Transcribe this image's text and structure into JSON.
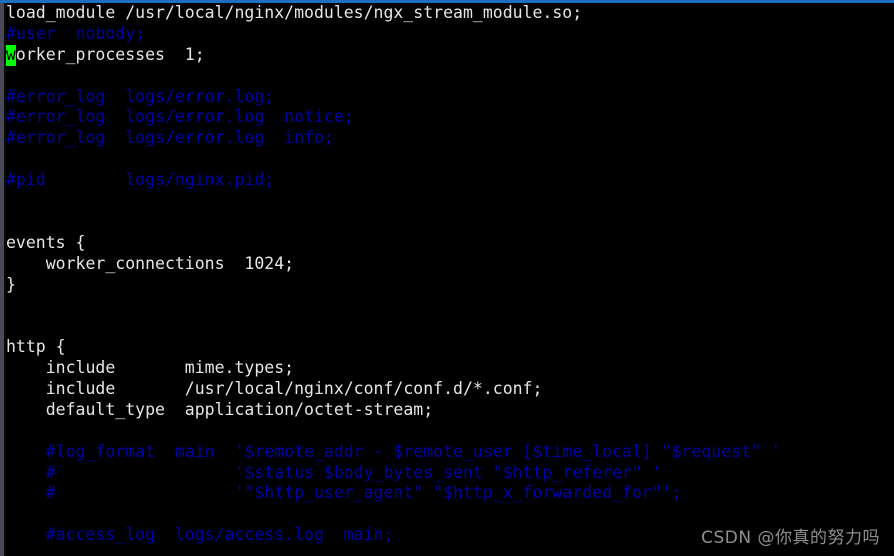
{
  "window": {
    "type": "terminal-emulator",
    "background_color": "#000000",
    "titlebar_accent_color": "#1d6fc0",
    "gutter_color": "#4b4b57"
  },
  "editor": {
    "file_kind": "nginx-configuration",
    "foreground_color": "#e6e6e6",
    "comment_color": "#0000aa",
    "cursor": {
      "color": "#00ff00",
      "char": "w",
      "line_index": 2,
      "column_index": 0
    },
    "lines": [
      {
        "text": "load_module /usr/local/nginx/modules/ngx_stream_module.so;",
        "style": "normal"
      },
      {
        "text": "#user  nobody;",
        "style": "comment"
      },
      {
        "text": "worker_processes  1;",
        "style": "normal"
      },
      {
        "text": "",
        "style": "blank"
      },
      {
        "text": "#error_log  logs/error.log;",
        "style": "comment"
      },
      {
        "text": "#error_log  logs/error.log  notice;",
        "style": "comment"
      },
      {
        "text": "#error_log  logs/error.log  info;",
        "style": "comment"
      },
      {
        "text": "",
        "style": "blank"
      },
      {
        "text": "#pid        logs/nginx.pid;",
        "style": "comment"
      },
      {
        "text": "",
        "style": "blank"
      },
      {
        "text": "",
        "style": "blank"
      },
      {
        "text": "events {",
        "style": "normal"
      },
      {
        "text": "    worker_connections  1024;",
        "style": "normal"
      },
      {
        "text": "}",
        "style": "normal"
      },
      {
        "text": "",
        "style": "blank"
      },
      {
        "text": "",
        "style": "blank"
      },
      {
        "text": "http {",
        "style": "normal"
      },
      {
        "text": "    include       mime.types;",
        "style": "normal"
      },
      {
        "text": "    include       /usr/local/nginx/conf/conf.d/*.conf;",
        "style": "normal"
      },
      {
        "text": "    default_type  application/octet-stream;",
        "style": "normal"
      },
      {
        "text": "",
        "style": "blank"
      },
      {
        "text": "    #log_format  main  '$remote_addr - $remote_user [$time_local] \"$request\" '",
        "style": "comment"
      },
      {
        "text": "    #                  '$status $body_bytes_sent \"$http_referer\" '",
        "style": "comment"
      },
      {
        "text": "    #                  '\"$http_user_agent\" \"$http_x_forwarded_for\"';",
        "style": "comment"
      },
      {
        "text": "",
        "style": "blank"
      },
      {
        "text": "    #access_log  logs/access.log  main;",
        "style": "comment"
      }
    ]
  },
  "watermark": {
    "text": "CSDN @你真的努力吗",
    "color": "#8f8f8f"
  }
}
